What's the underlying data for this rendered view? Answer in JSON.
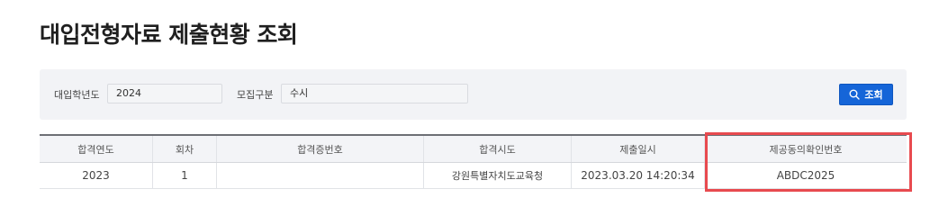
{
  "page": {
    "title": "대입전형자료 제출현황 조회"
  },
  "search": {
    "year_label": "대입학년도",
    "year_value": "2024",
    "type_label": "모집구분",
    "type_value": "수시",
    "button_label": "조회",
    "button_icon": "search-icon"
  },
  "table": {
    "headers": [
      "합격연도",
      "회차",
      "합격증번호",
      "합격시도",
      "제출일시",
      "제공동의확인번호"
    ],
    "rows": [
      [
        "2023",
        "1",
        "",
        "강원특별자치도교육청",
        "2023.03.20 14:20:34",
        "ABDC2025"
      ]
    ]
  },
  "colors": {
    "accent": "#1565d8",
    "highlight": "#e84a4f"
  }
}
